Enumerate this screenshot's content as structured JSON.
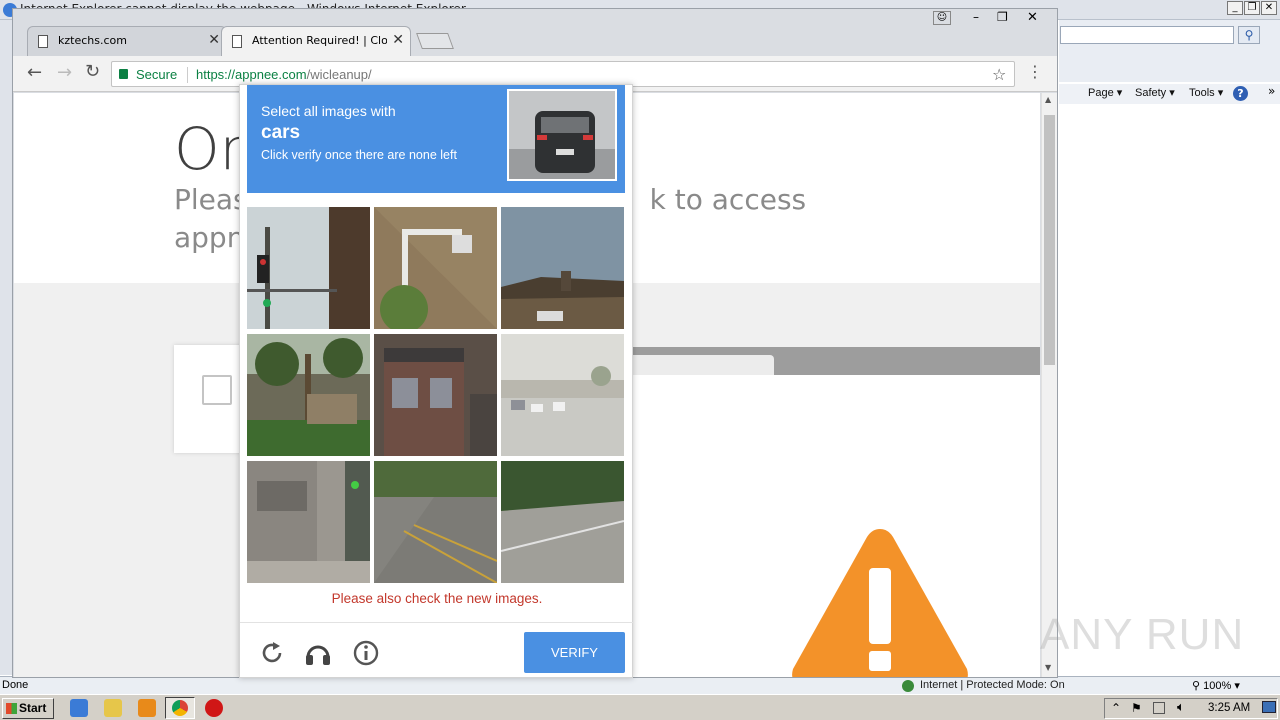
{
  "ie": {
    "title": "Internet Explorer cannot display the webpage - Windows Internet Explorer",
    "commands": [
      "Page ▾",
      "Safety ▾",
      "Tools ▾"
    ],
    "status_left": "Done",
    "status_zone": "Internet | Protected Mode: On",
    "zoom": "100%"
  },
  "chrome": {
    "tabs": [
      {
        "label": "kztechs.com",
        "active": false
      },
      {
        "label": "Attention Required! | Cloudflare",
        "active": true
      }
    ],
    "secure_label": "Secure",
    "url_scheme_host": "https://appnee.com",
    "url_path": "/wicleanup/"
  },
  "page": {
    "heading": "On",
    "subtitle_line1_start": "Pleas",
    "subtitle_line1_end": "k to access",
    "subtitle_line2": "appn"
  },
  "captcha": {
    "instruction": "Select all images with",
    "target": "cars",
    "hint": "Click verify once there are none left",
    "error": "Please also check the new images.",
    "verify_label": "VERIFY",
    "icons": [
      "reload-icon",
      "audio-icon",
      "info-icon"
    ]
  },
  "taskbar": {
    "start_label": "Start",
    "clock": "3:25 AM"
  },
  "watermark": "ANY RUN",
  "colors": {
    "captcha_blue": "#4a90e2",
    "error_red": "#c3382c",
    "warning_orange": "#f39229",
    "secure_green": "#0b8043"
  }
}
